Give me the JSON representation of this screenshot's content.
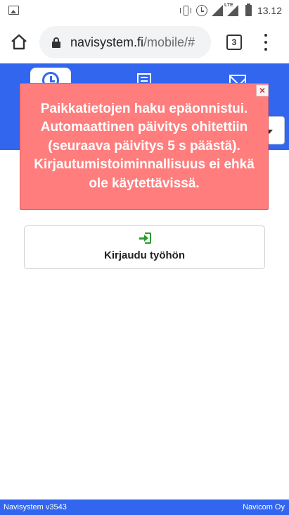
{
  "status_bar": {
    "time": "13.12",
    "network_label": "LTE",
    "icons": [
      "image-icon",
      "vibrate-icon",
      "alarm-icon",
      "signal-icon",
      "lte-signal-icon",
      "battery-icon"
    ]
  },
  "browser": {
    "url_domain": "navisystem.fi",
    "url_path": "/mobile/#",
    "tab_count": "3",
    "icons": [
      "home-icon",
      "lock-icon",
      "tabs-icon",
      "menu-icon"
    ]
  },
  "app_nav": {
    "tabs": [
      {
        "icon": "clock-icon",
        "active": true
      },
      {
        "icon": "list-icon",
        "active": false
      },
      {
        "icon": "mail-icon",
        "active": false
      }
    ],
    "dropdown_icon": "caret-down-icon"
  },
  "alert": {
    "message": "Paikkatietojen haku epäonnistui. Automaattinen päivitys ohitettiin (seuraava päivitys 5 s päästä). Kirjautumistoiminnallisuus ei ehkä ole käytettävissä.",
    "close_label": "×",
    "background_color": "#ff7d7d"
  },
  "login": {
    "label": "Kirjaudu työhön",
    "icon": "sign-in-icon",
    "icon_color": "#2a9d2a"
  },
  "footer": {
    "left": "Navisystem v3543",
    "right": "Navicom Oy"
  },
  "colors": {
    "brand_blue": "#3366ee"
  }
}
